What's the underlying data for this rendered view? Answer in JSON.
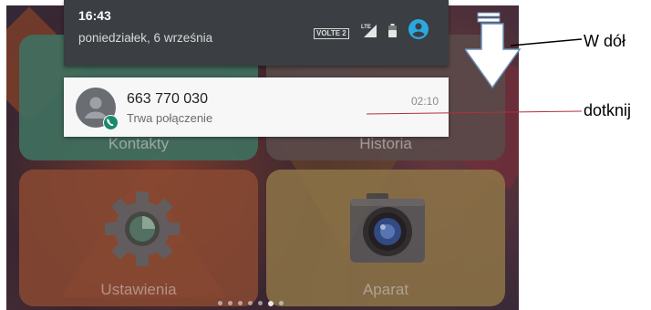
{
  "status": {
    "time": "16:43",
    "date": "poniedziałek, 6 września",
    "volte_badge": "VOLTE 2",
    "network_icon": "lte-signal-icon",
    "battery_icon": "battery-icon",
    "account_icon": "account-circle-icon"
  },
  "notification": {
    "caller_number": "663 770 030",
    "call_status": "Trwa połączenie",
    "call_duration": "02:10",
    "avatar_icon": "contact-avatar-icon",
    "badge_icon": "phone-call-icon"
  },
  "home": {
    "folders": [
      {
        "label": "Kontakty"
      },
      {
        "label": "Historia"
      },
      {
        "label": "Ustawienia"
      },
      {
        "label": "Aparat"
      }
    ],
    "page_count": 7,
    "active_page": 5
  },
  "annotations": {
    "swipe_hint": "W dół",
    "tap_hint": "dotknij"
  },
  "colors": {
    "shade_bg": "#3b3e42",
    "accent_blue": "#2aa8e0",
    "call_green": "#1b8a6b",
    "tap_line": "#b0303a",
    "arrow_fill": "#ffffff",
    "arrow_stroke": "#6a8fb8"
  }
}
